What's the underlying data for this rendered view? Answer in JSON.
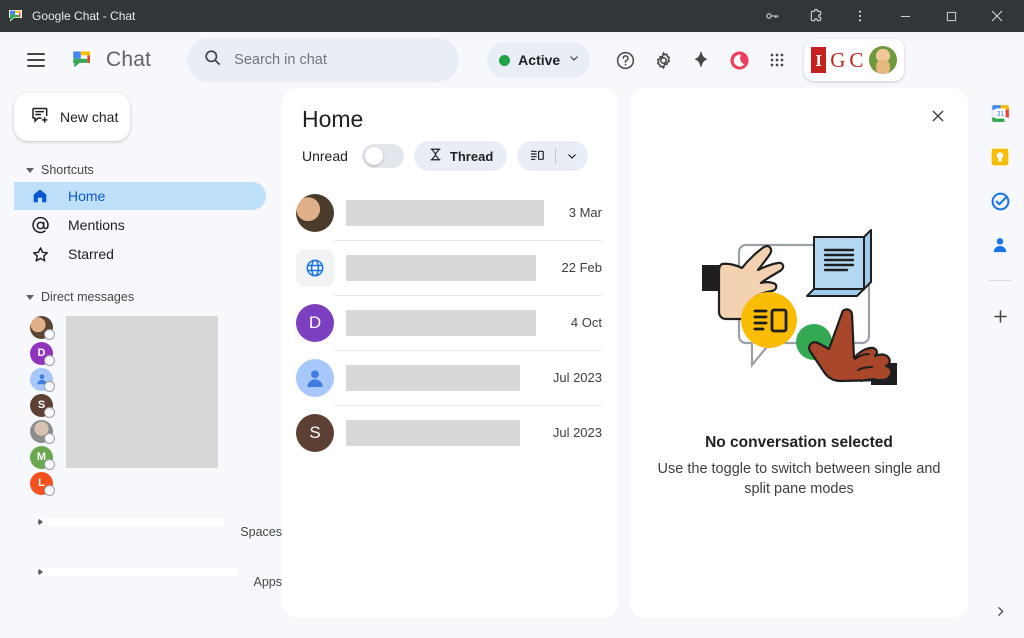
{
  "window": {
    "title": "Google Chat - Chat",
    "app_icon": "google-chat-icon",
    "controls": {
      "passwords": "key-icon",
      "extensions": "puzzle-piece-icon",
      "more": "kebab-menu-icon",
      "minimize": "minimize-icon",
      "maximize": "maximize-icon",
      "close": "close-icon"
    }
  },
  "header": {
    "menu_icon": "hamburger-menu-icon",
    "logo_icon": "google-chat-logo-icon",
    "brand": "Chat",
    "search": {
      "placeholder": "Search in chat",
      "value": "",
      "icon": "search-icon"
    },
    "status": {
      "label": "Active",
      "dot_color": "#1ea446",
      "chevron": "chevron-down-icon"
    },
    "icons": [
      {
        "name": "help-icon",
        "glyph": "?"
      },
      {
        "name": "settings-gear-icon",
        "glyph": "gear"
      },
      {
        "name": "gemini-spark-icon",
        "glyph": "spark"
      },
      {
        "name": "do-not-disturb-icon",
        "glyph": "moon",
        "color": "#ef3e5b"
      },
      {
        "name": "google-apps-grid-icon",
        "glyph": "grid"
      }
    ],
    "account": {
      "org_logo": "IGC",
      "org_color": "#c5221f",
      "avatar": "user-avatar"
    }
  },
  "sidebar": {
    "new_chat": {
      "label": "New chat",
      "icon": "new-chat-icon"
    },
    "sections": [
      {
        "title": "Shortcuts",
        "expanded": true,
        "items": [
          {
            "label": "Home",
            "icon": "home-icon",
            "active": true
          },
          {
            "label": "Mentions",
            "icon": "at-mention-icon",
            "active": false
          },
          {
            "label": "Starred",
            "icon": "star-icon",
            "active": false
          }
        ]
      },
      {
        "title": "Direct messages",
        "expanded": true,
        "items": []
      },
      {
        "title": "Spaces",
        "expanded": false,
        "items": []
      },
      {
        "title": "Apps",
        "expanded": false,
        "items": []
      }
    ],
    "direct_messages": [
      {
        "initial": "",
        "color": "#8a6a52",
        "type": "photo"
      },
      {
        "initial": "D",
        "color": "#9334bf",
        "type": "letter"
      },
      {
        "initial": "",
        "color": "#a8c7fa",
        "type": "person"
      },
      {
        "initial": "S",
        "color": "#5c4033",
        "type": "letter"
      },
      {
        "initial": "",
        "color": "#9e9e9e",
        "type": "photo"
      },
      {
        "initial": "M",
        "color": "#6aa84f",
        "type": "letter"
      },
      {
        "initial": "L",
        "color": "#f4511e",
        "type": "letter"
      }
    ]
  },
  "center_panel": {
    "title": "Home",
    "unread_label": "Unread",
    "unread_on": false,
    "thread_chip": {
      "label": "Thread",
      "icon": "thread-icon"
    },
    "layout_chip": {
      "icon": "split-pane-icon",
      "chevron": "chevron-down-icon"
    },
    "chats": [
      {
        "avatar_type": "photo",
        "avatar_color": "#8a6a52",
        "initial": "",
        "name": "",
        "snippet": "",
        "date": "3 Mar",
        "redacted": true,
        "redact_width": 198
      },
      {
        "avatar_type": "globe",
        "avatar_color": "#4285f4",
        "initial": "",
        "name": "",
        "snippet": "",
        "date": "22 Feb",
        "redacted": true,
        "redact_width": 190
      },
      {
        "avatar_type": "letter",
        "avatar_color": "#7b3fbf",
        "initial": "D",
        "name": "",
        "snippet": "",
        "date": "4 Oct",
        "redacted": true,
        "redact_width": 190
      },
      {
        "avatar_type": "person",
        "avatar_color": "#a8c7fa",
        "initial": "",
        "name": "",
        "snippet": "",
        "date": "Jul 2023",
        "redacted": true,
        "redact_width": 174
      },
      {
        "avatar_type": "letter",
        "avatar_color": "#5c4033",
        "initial": "S",
        "name": "",
        "snippet": "",
        "date": "Jul 2023",
        "redacted": true,
        "redact_width": 174
      }
    ]
  },
  "right_panel": {
    "close_icon": "close-icon",
    "illustration": "hands-and-panes-illustration",
    "title": "No conversation selected",
    "subtitle": "Use the toggle to switch between single and split pane modes"
  },
  "rail": {
    "items": [
      {
        "name": "google-calendar-icon"
      },
      {
        "name": "google-keep-icon"
      },
      {
        "name": "google-tasks-icon"
      },
      {
        "name": "google-contacts-icon"
      },
      {
        "name": "add-shortcut-icon"
      }
    ],
    "expand_icon": "chevron-right-icon"
  }
}
